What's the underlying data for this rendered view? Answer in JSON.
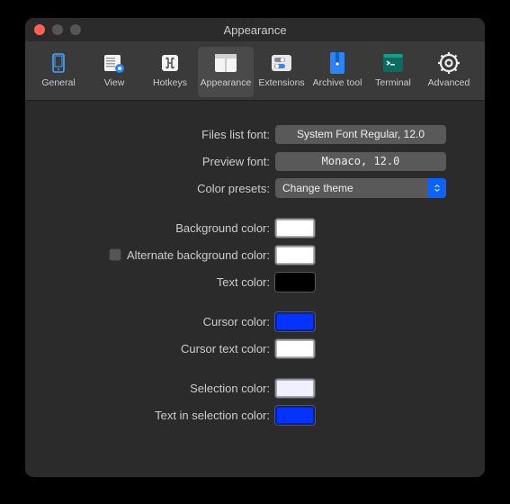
{
  "window": {
    "title": "Appearance"
  },
  "toolbar": {
    "items": [
      {
        "label": "General"
      },
      {
        "label": "View"
      },
      {
        "label": "Hotkeys"
      },
      {
        "label": "Appearance"
      },
      {
        "label": "Extensions"
      },
      {
        "label": "Archive tool"
      },
      {
        "label": "Terminal"
      },
      {
        "label": "Advanced"
      }
    ]
  },
  "form": {
    "files_list_font_label": "Files list font:",
    "files_list_font_value": "System Font Regular, 12.0",
    "preview_font_label": "Preview font:",
    "preview_font_value": "Monaco, 12.0",
    "color_presets_label": "Color presets:",
    "color_presets_value": "Change theme",
    "background_color_label": "Background color:",
    "background_color_value": "#ffffff",
    "alt_background_color_label": "Alternate background color:",
    "alt_background_color_value": "#ffffff",
    "text_color_label": "Text color:",
    "text_color_value": "#000000",
    "cursor_color_label": "Cursor color:",
    "cursor_color_value": "#0433ff",
    "cursor_text_color_label": "Cursor text color:",
    "cursor_text_color_value": "#ffffff",
    "selection_color_label": "Selection color:",
    "selection_color_value": "#f0f0ff",
    "text_in_selection_color_label": "Text in selection color:",
    "text_in_selection_color_value": "#0433ff"
  }
}
